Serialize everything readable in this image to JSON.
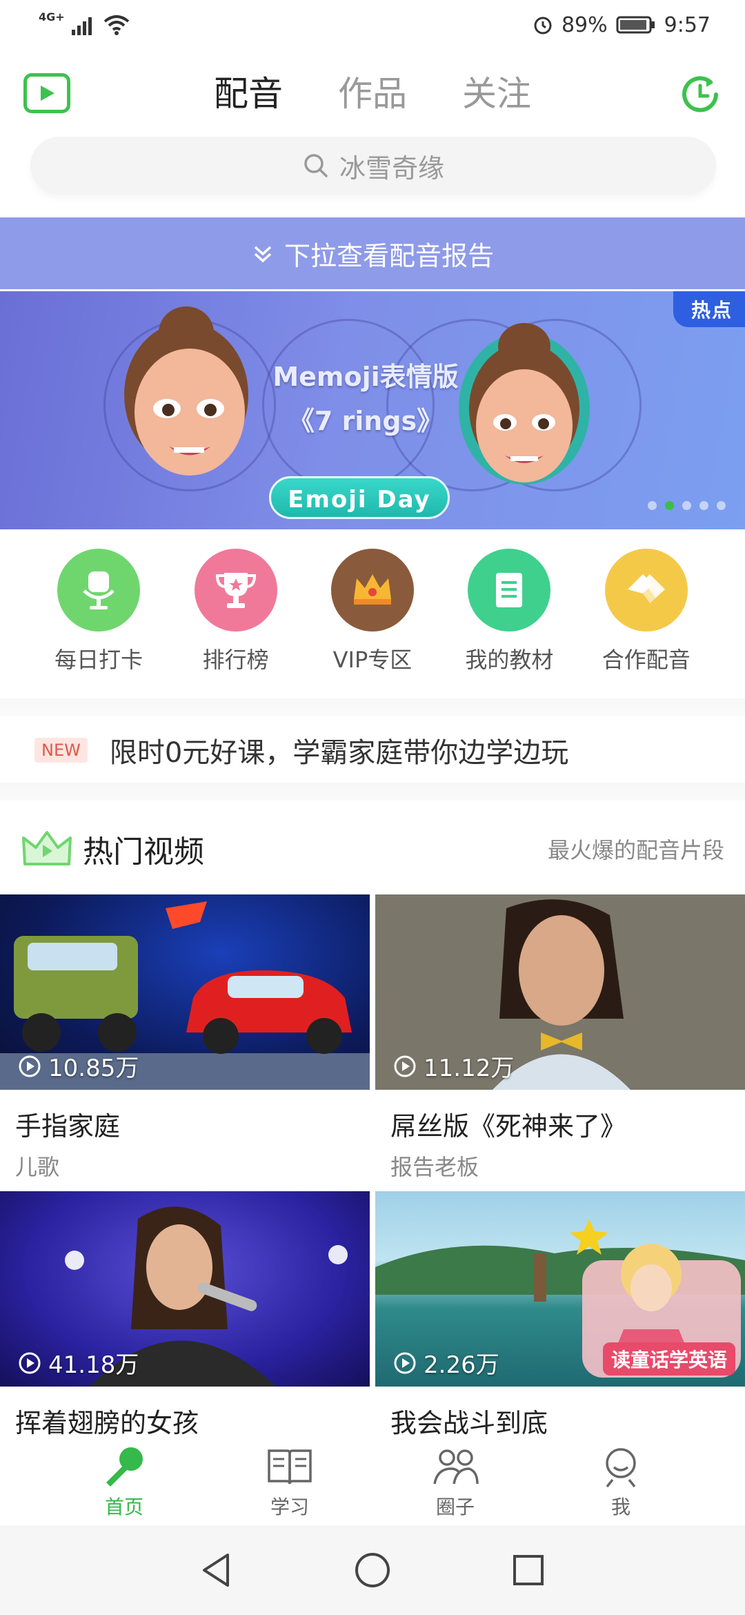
{
  "status_bar": {
    "network": "4G+",
    "battery": "89%",
    "time": "9:57"
  },
  "top_nav": {
    "tabs": [
      {
        "label": "配音",
        "active": true
      },
      {
        "label": "作品",
        "active": false
      },
      {
        "label": "关注",
        "active": false
      }
    ]
  },
  "search": {
    "placeholder": "冰雪奇缘"
  },
  "pull_report": {
    "label": "下拉查看配音报告"
  },
  "banner": {
    "hot_tag": "热点",
    "title_line1": "Memoji表情版",
    "title_line2": "《7 rings》",
    "button": "Emoji Day",
    "page_count": 5,
    "active_page": 2
  },
  "quick_links": [
    {
      "label": "每日打卡",
      "icon": "microphone-icon",
      "color": "#6fd66e"
    },
    {
      "label": "排行榜",
      "icon": "trophy-icon",
      "color": "#f0799a"
    },
    {
      "label": "VIP专区",
      "icon": "crown-icon",
      "color": "#8a5a3c"
    },
    {
      "label": "我的教材",
      "icon": "book-icon",
      "color": "#3fd08e"
    },
    {
      "label": "合作配音",
      "icon": "handshake-icon",
      "color": "#f5c948"
    }
  ],
  "promo": {
    "badge": "NEW",
    "text": "限时0元好课，学霸家庭带你边学边玩"
  },
  "hot_section": {
    "title": "热门视频",
    "subtitle": "最火爆的配音片段"
  },
  "videos": [
    {
      "views": "10.85万",
      "title": "手指家庭",
      "sub": "儿歌"
    },
    {
      "views": "11.12万",
      "title": "屌丝版《死神来了》",
      "sub": "报告老板"
    },
    {
      "views": "41.18万",
      "title": "挥着翅膀的女孩",
      "sub": ""
    },
    {
      "views": "2.26万",
      "title": "我会战斗到底",
      "sub": "",
      "overlay": "读童话学英语"
    }
  ],
  "bottom_tabs": [
    {
      "label": "首页",
      "icon": "microphone-icon",
      "active": true
    },
    {
      "label": "学习",
      "icon": "book-open-icon",
      "active": false
    },
    {
      "label": "圈子",
      "icon": "group-icon",
      "active": false
    },
    {
      "label": "我",
      "icon": "user-icon",
      "active": false
    }
  ],
  "colors": {
    "accent": "#3cc24e",
    "pull_report_bg": "#8e9be8",
    "hot_tag_bg": "#2e5fe0"
  }
}
